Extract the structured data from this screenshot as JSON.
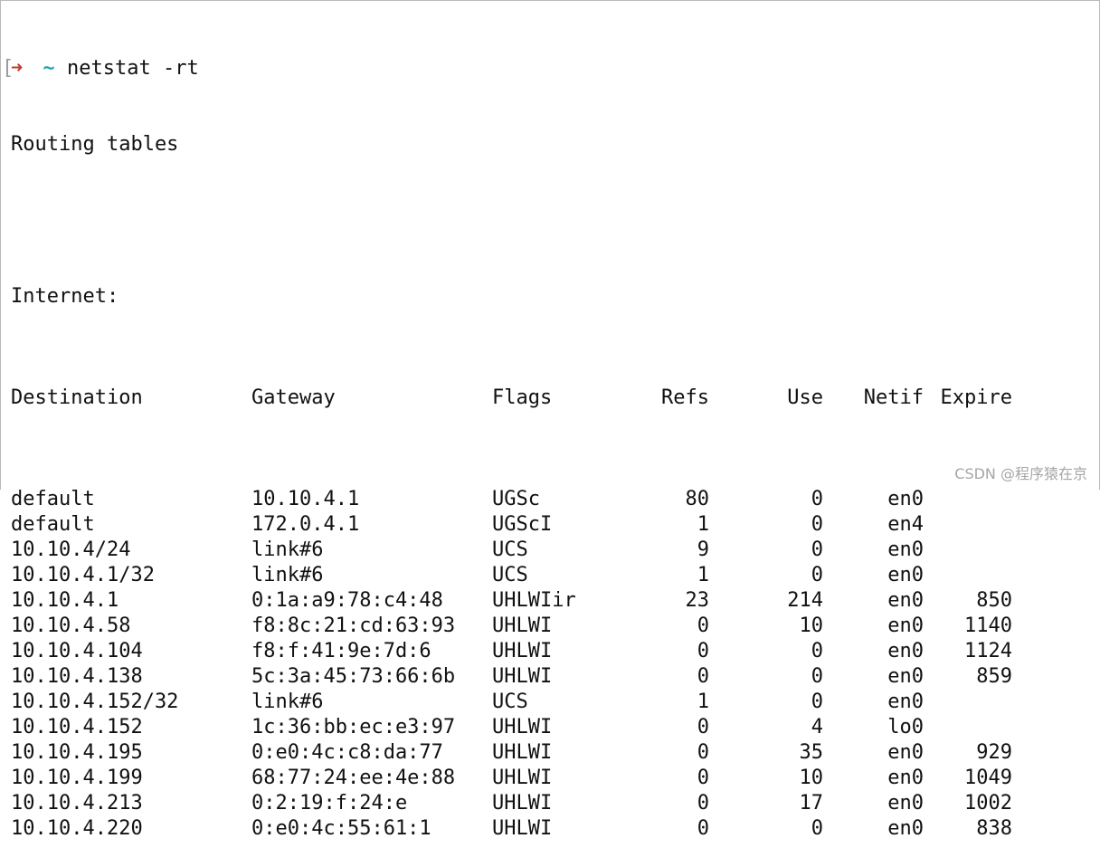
{
  "terminal": {
    "prompt_arrow": "➜",
    "prompt_dir": "~",
    "command": "netstat -rt",
    "title_line": "Routing tables",
    "section": "Internet:",
    "headers": {
      "destination": "Destination",
      "gateway": "Gateway",
      "flags": "Flags",
      "refs": "Refs",
      "use": "Use",
      "netif": "Netif",
      "expire": "Expire"
    },
    "rows": [
      {
        "destination": "default",
        "gateway": "10.10.4.1",
        "flags": "UGSc",
        "refs": "80",
        "use": "0",
        "netif": "en0",
        "expire": ""
      },
      {
        "destination": "default",
        "gateway": "172.0.4.1",
        "flags": "UGScI",
        "refs": "1",
        "use": "0",
        "netif": "en4",
        "expire": ""
      },
      {
        "destination": "10.10.4/24",
        "gateway": "link#6",
        "flags": "UCS",
        "refs": "9",
        "use": "0",
        "netif": "en0",
        "expire": ""
      },
      {
        "destination": "10.10.4.1/32",
        "gateway": "link#6",
        "flags": "UCS",
        "refs": "1",
        "use": "0",
        "netif": "en0",
        "expire": ""
      },
      {
        "destination": "10.10.4.1",
        "gateway": "0:1a:a9:78:c4:48",
        "flags": "UHLWIir",
        "refs": "23",
        "use": "214",
        "netif": "en0",
        "expire": "850"
      },
      {
        "destination": "10.10.4.58",
        "gateway": "f8:8c:21:cd:63:93",
        "flags": "UHLWI",
        "refs": "0",
        "use": "10",
        "netif": "en0",
        "expire": "1140"
      },
      {
        "destination": "10.10.4.104",
        "gateway": "f8:f:41:9e:7d:6",
        "flags": "UHLWI",
        "refs": "0",
        "use": "0",
        "netif": "en0",
        "expire": "1124"
      },
      {
        "destination": "10.10.4.138",
        "gateway": "5c:3a:45:73:66:6b",
        "flags": "UHLWI",
        "refs": "0",
        "use": "0",
        "netif": "en0",
        "expire": "859"
      },
      {
        "destination": "10.10.4.152/32",
        "gateway": "link#6",
        "flags": "UCS",
        "refs": "1",
        "use": "0",
        "netif": "en0",
        "expire": ""
      },
      {
        "destination": "10.10.4.152",
        "gateway": "1c:36:bb:ec:e3:97",
        "flags": "UHLWI",
        "refs": "0",
        "use": "4",
        "netif": "lo0",
        "expire": ""
      },
      {
        "destination": "10.10.4.195",
        "gateway": "0:e0:4c:c8:da:77",
        "flags": "UHLWI",
        "refs": "0",
        "use": "35",
        "netif": "en0",
        "expire": "929"
      },
      {
        "destination": "10.10.4.199",
        "gateway": "68:77:24:ee:4e:88",
        "flags": "UHLWI",
        "refs": "0",
        "use": "10",
        "netif": "en0",
        "expire": "1049"
      },
      {
        "destination": "10.10.4.213",
        "gateway": "0:2:19:f:24:e",
        "flags": "UHLWI",
        "refs": "0",
        "use": "17",
        "netif": "en0",
        "expire": "1002"
      },
      {
        "destination": "10.10.4.220",
        "gateway": "0:e0:4c:55:61:1",
        "flags": "UHLWI",
        "refs": "0",
        "use": "0",
        "netif": "en0",
        "expire": "838"
      }
    ]
  },
  "watermark": "CSDN @程序猿在京",
  "colors": {
    "prompt_arrow": "#c0392b",
    "prompt_dir": "#2aa1b3",
    "text": "#111111",
    "background": "#ffffff"
  }
}
